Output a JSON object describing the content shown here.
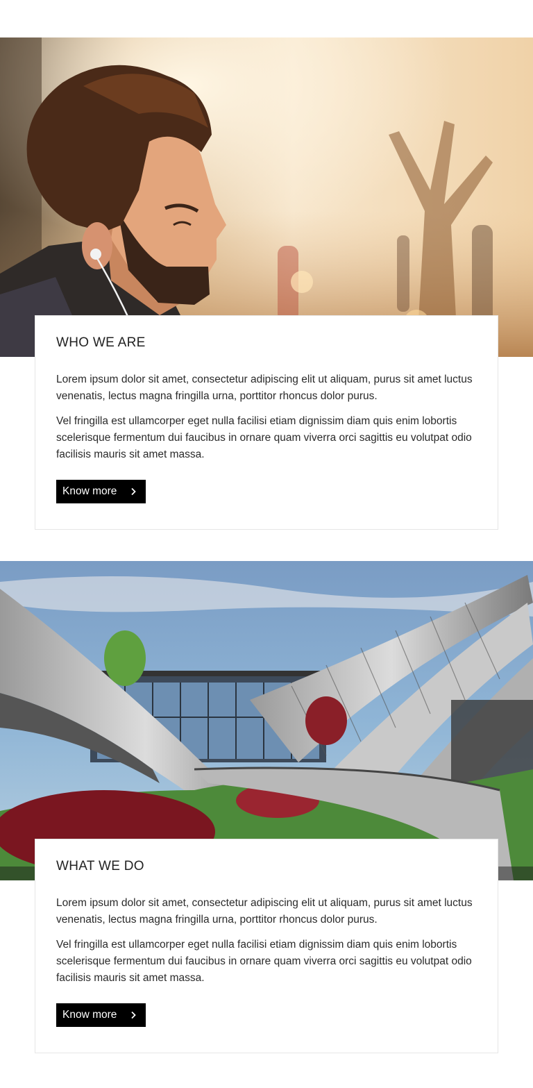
{
  "sections": [
    {
      "image": "man-with-earphones-photo",
      "title": "WHO WE ARE",
      "paragraphs": [
        "Lorem ipsum dolor sit amet, consectetur adipiscing elit ut aliquam, purus sit amet luctus venenatis, lectus magna fringilla urna, porttitor rhoncus dolor purus.",
        "Vel fringilla est ullamcorper eget nulla facilisi etiam dignissim diam quis enim lobortis scelerisque fermentum dui faucibus in ornare quam viverra orci sagittis eu volutpat odio facilisis mauris sit amet massa."
      ],
      "button_label": "Know more",
      "button_icon": "chevron-right-icon"
    },
    {
      "image": "modern-wave-building-photo",
      "title": "WHAT WE DO",
      "paragraphs": [
        "Lorem ipsum dolor sit amet, consectetur adipiscing elit ut aliquam, purus sit amet luctus venenatis, lectus magna fringilla urna, porttitor rhoncus dolor purus.",
        "Vel fringilla est ullamcorper eget nulla facilisi etiam dignissim diam quis enim lobortis scelerisque fermentum dui faucibus in ornare quam viverra orci sagittis eu volutpat odio facilisis mauris sit amet massa."
      ],
      "button_label": "Know more",
      "button_icon": "chevron-right-icon"
    }
  ],
  "colors": {
    "background": "#ffffff",
    "button_bg": "#000000",
    "button_text": "#ffffff",
    "card_border": "#e6e6e6",
    "text": "#222222"
  }
}
